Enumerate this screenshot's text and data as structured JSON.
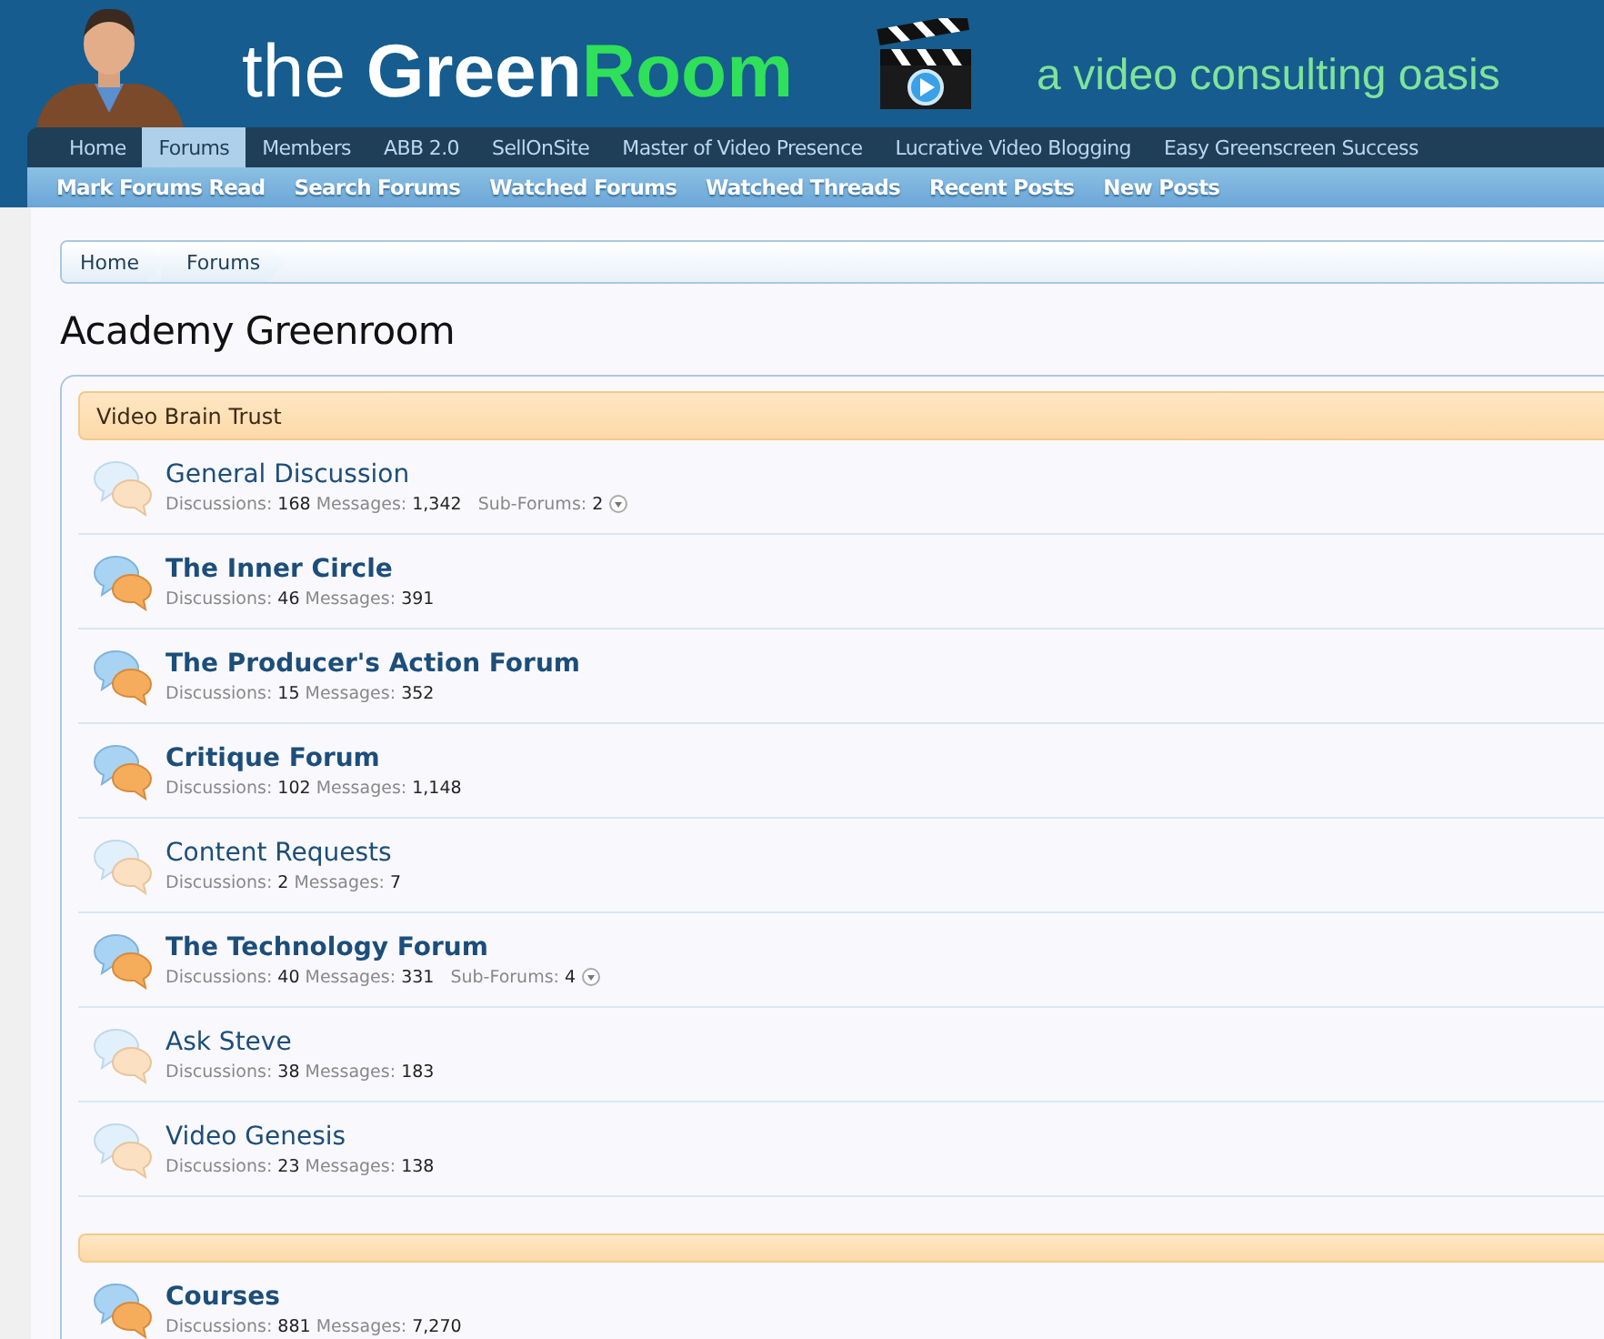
{
  "header": {
    "logo": {
      "light": "the ",
      "bold": "Green",
      "accent": "Room"
    },
    "tagline": "a video consulting oasis"
  },
  "tabs": [
    {
      "label": "Home",
      "selected": false
    },
    {
      "label": "Forums",
      "selected": true
    },
    {
      "label": "Members",
      "selected": false
    },
    {
      "label": "ABB 2.0",
      "selected": false
    },
    {
      "label": "SellOnSite",
      "selected": false
    },
    {
      "label": "Master of Video Presence",
      "selected": false
    },
    {
      "label": "Lucrative Video Blogging",
      "selected": false
    },
    {
      "label": "Easy Greenscreen Success",
      "selected": false
    }
  ],
  "subnav": [
    "Mark Forums Read",
    "Search Forums",
    "Watched Forums",
    "Watched Threads",
    "Recent Posts",
    "New Posts"
  ],
  "breadcrumb": [
    "Home",
    "Forums"
  ],
  "page_title": "Academy Greenroom",
  "categories": [
    {
      "title": "Video Brain Trust",
      "forums": [
        {
          "title": "General Discussion",
          "unread": false,
          "stats": [
            {
              "kind": "count",
              "label": "Discussions:",
              "value": "168"
            },
            {
              "kind": "count",
              "label": "Messages:",
              "value": "1,342"
            },
            {
              "kind": "subforums",
              "label": "Sub-Forums:",
              "value": "2"
            }
          ]
        },
        {
          "title": "The Inner Circle",
          "unread": true,
          "stats": [
            {
              "kind": "count",
              "label": "Discussions:",
              "value": "46"
            },
            {
              "kind": "count",
              "label": "Messages:",
              "value": "391"
            }
          ]
        },
        {
          "title": "The Producer's Action Forum",
          "unread": true,
          "stats": [
            {
              "kind": "count",
              "label": "Discussions:",
              "value": "15"
            },
            {
              "kind": "count",
              "label": "Messages:",
              "value": "352"
            }
          ]
        },
        {
          "title": "Critique Forum",
          "unread": true,
          "stats": [
            {
              "kind": "count",
              "label": "Discussions:",
              "value": "102"
            },
            {
              "kind": "count",
              "label": "Messages:",
              "value": "1,148"
            }
          ]
        },
        {
          "title": "Content Requests",
          "unread": false,
          "stats": [
            {
              "kind": "count",
              "label": "Discussions:",
              "value": "2"
            },
            {
              "kind": "count",
              "label": "Messages:",
              "value": "7"
            }
          ]
        },
        {
          "title": "The Technology Forum",
          "unread": true,
          "stats": [
            {
              "kind": "count",
              "label": "Discussions:",
              "value": "40"
            },
            {
              "kind": "count",
              "label": "Messages:",
              "value": "331"
            },
            {
              "kind": "subforums",
              "label": "Sub-Forums:",
              "value": "4"
            }
          ]
        },
        {
          "title": "Ask Steve",
          "unread": false,
          "stats": [
            {
              "kind": "count",
              "label": "Discussions:",
              "value": "38"
            },
            {
              "kind": "count",
              "label": "Messages:",
              "value": "183"
            }
          ]
        },
        {
          "title": "Video Genesis",
          "unread": false,
          "stats": [
            {
              "kind": "count",
              "label": "Discussions:",
              "value": "23"
            },
            {
              "kind": "count",
              "label": "Messages:",
              "value": "138"
            }
          ]
        }
      ]
    },
    {
      "forums": [
        {
          "title": "Courses",
          "unread": true,
          "stats": [
            {
              "kind": "count",
              "label": "Discussions:",
              "value": "881"
            },
            {
              "kind": "count",
              "label": "Messages:",
              "value": "7,270"
            }
          ]
        }
      ]
    }
  ]
}
